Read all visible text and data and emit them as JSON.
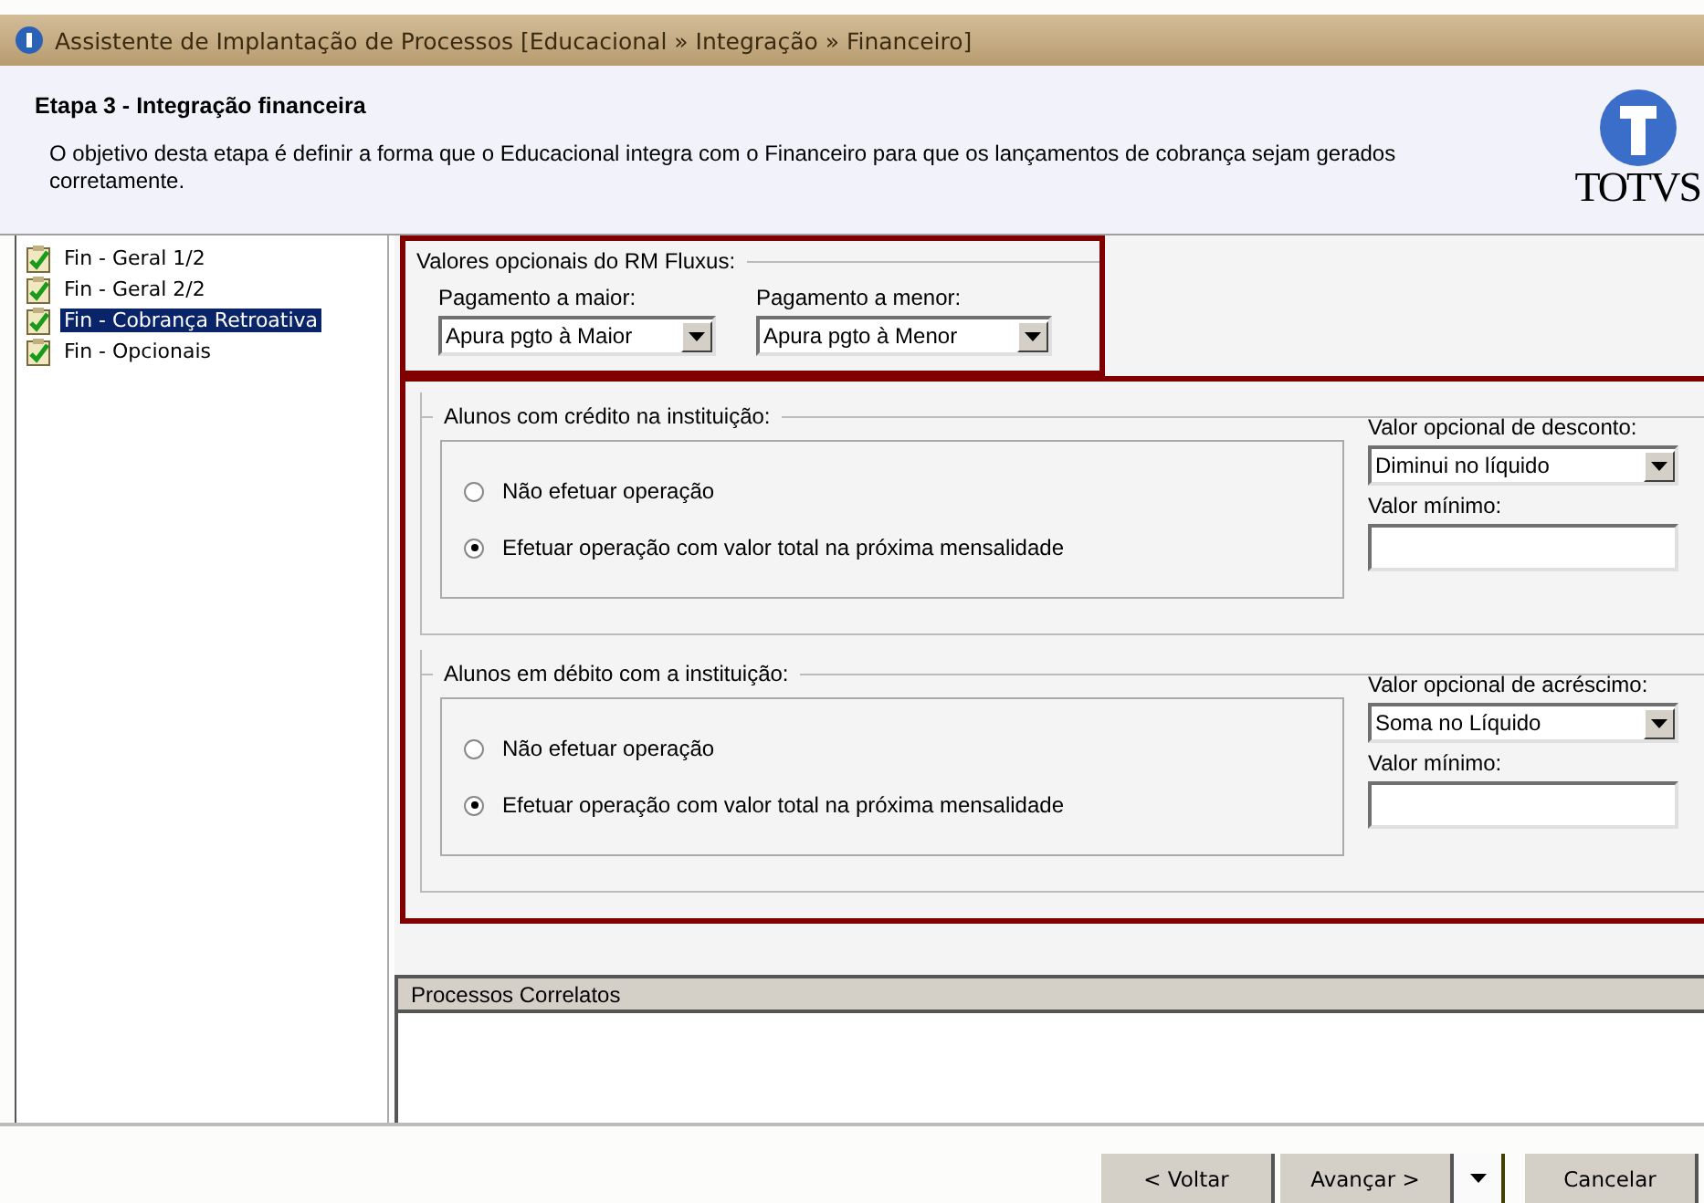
{
  "window": {
    "title": "Assistente de Implantação de Processos [Educacional » Integração » Financeiro]"
  },
  "header": {
    "step_title": "Etapa 3 - Integração financeira",
    "description": "O objetivo desta etapa é definir a forma que o Educacional integra com o Financeiro para que os lançamentos de cobrança sejam gerados corretamente.",
    "logo_text": "TOTVS"
  },
  "sidebar": {
    "items": [
      {
        "label": "Fin - Geral 1/2",
        "checked": true,
        "selected": false
      },
      {
        "label": "Fin - Geral 2/2",
        "checked": true,
        "selected": false
      },
      {
        "label": "Fin - Cobrança Retroativa",
        "checked": true,
        "selected": true
      },
      {
        "label": "Fin - Opcionais",
        "checked": true,
        "selected": false
      }
    ]
  },
  "fluxus": {
    "title": "Valores opcionais do RM Fluxus:",
    "fields": [
      {
        "label": "Pagamento a maior:",
        "value": "Apura pgto à Maior"
      },
      {
        "label": "Pagamento a menor:",
        "value": "Apura pgto à Menor"
      }
    ]
  },
  "groups": [
    {
      "title": "Alunos com crédito na instituição:",
      "options": [
        {
          "label": "Não efetuar operação",
          "selected": false
        },
        {
          "label": "Efetuar operação com valor total na próxima mensalidade",
          "selected": true
        }
      ],
      "fields": [
        {
          "kind": "select",
          "label": "Valor opcional de desconto:",
          "value": "Diminui no líquido"
        },
        {
          "kind": "input",
          "label": "Valor mínimo:"
        }
      ]
    },
    {
      "title": "Alunos em débito com a instituição:",
      "options": [
        {
          "label": "Não efetuar operação",
          "selected": false
        },
        {
          "label": "Efetuar operação com valor total na próxima mensalidade",
          "selected": true
        }
      ],
      "fields": [
        {
          "kind": "select",
          "label": "Valor opcional de acréscimo:",
          "value": "Soma no Líquido"
        },
        {
          "kind": "input",
          "label": "Valor mínimo:"
        }
      ]
    }
  ],
  "related": {
    "title": "Processos Correlatos"
  },
  "buttons": [
    {
      "kind": "button",
      "label": "< Voltar"
    },
    {
      "kind": "button",
      "label": "Avançar >"
    },
    {
      "kind": "menu"
    },
    {
      "kind": "button",
      "label": "Cancelar"
    }
  ]
}
